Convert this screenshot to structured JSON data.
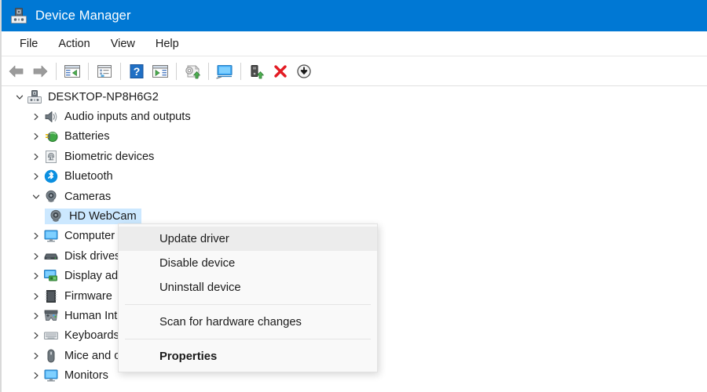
{
  "window": {
    "title": "Device Manager",
    "title_icon": "device-manager-icon",
    "accent_color": "#0078d4",
    "background_color": "#ffffff"
  },
  "menubar": {
    "items": [
      {
        "label": "File"
      },
      {
        "label": "Action"
      },
      {
        "label": "View"
      },
      {
        "label": "Help"
      }
    ]
  },
  "toolbar": {
    "buttons": [
      {
        "icon": "back-arrow-icon",
        "tooltip": "Back"
      },
      {
        "icon": "forward-arrow-icon",
        "tooltip": "Forward"
      },
      {
        "icon": "show-hide-console-tree-icon",
        "tooltip": "Show/Hide Console Tree"
      },
      {
        "icon": "properties-icon",
        "tooltip": "Properties"
      },
      {
        "icon": "help-icon",
        "tooltip": "Help"
      },
      {
        "icon": "show-hide-action-pane-icon",
        "tooltip": "Show/Hide Action Pane"
      },
      {
        "icon": "update-driver-icon",
        "tooltip": "Update driver"
      },
      {
        "icon": "scan-for-hardware-changes-icon",
        "tooltip": "Scan for hardware changes"
      },
      {
        "icon": "uninstall-device-icon",
        "tooltip": "Uninstall device"
      },
      {
        "icon": "disable-device-icon",
        "tooltip": "Disable device"
      },
      {
        "icon": "enable-device-icon",
        "tooltip": "Enable device"
      }
    ]
  },
  "tree": {
    "selection_color": "#cce8ff",
    "root": {
      "label": "DESKTOP-NP8H6G2",
      "icon": "computer-icon",
      "expanded": true
    },
    "nodes": [
      {
        "label": "Audio inputs and outputs",
        "icon": "speaker-icon",
        "expanded": false,
        "level": 1
      },
      {
        "label": "Batteries",
        "icon": "battery-icon",
        "expanded": false,
        "level": 1
      },
      {
        "label": "Biometric devices",
        "icon": "fingerprint-icon",
        "expanded": false,
        "level": 1
      },
      {
        "label": "Bluetooth",
        "icon": "bluetooth-icon",
        "expanded": false,
        "level": 1
      },
      {
        "label": "Cameras",
        "icon": "camera-icon",
        "expanded": true,
        "level": 1
      },
      {
        "label": "HD WebCam",
        "icon": "camera-icon",
        "expanded": null,
        "level": 2,
        "selected": true
      },
      {
        "label": "Computer",
        "icon": "monitor-icon",
        "expanded": false,
        "level": 1
      },
      {
        "label": "Disk drives",
        "icon": "disk-drive-icon",
        "expanded": false,
        "level": 1
      },
      {
        "label": "Display adapters",
        "icon": "display-adapter-icon",
        "expanded": false,
        "level": 1
      },
      {
        "label": "Firmware",
        "icon": "firmware-chip-icon",
        "expanded": false,
        "level": 1
      },
      {
        "label": "Human Interface Devices",
        "icon": "hid-gamepad-icon",
        "expanded": false,
        "level": 1
      },
      {
        "label": "Keyboards",
        "icon": "keyboard-icon",
        "expanded": false,
        "level": 1
      },
      {
        "label": "Mice and other pointing devices",
        "icon": "mouse-icon",
        "expanded": false,
        "level": 1
      },
      {
        "label": "Monitors",
        "icon": "monitor-icon",
        "expanded": false,
        "level": 1
      }
    ]
  },
  "context_menu": {
    "visible": true,
    "target": "HD WebCam",
    "items": [
      {
        "label": "Update driver",
        "highlighted": true,
        "bold": false,
        "type": "item"
      },
      {
        "label": "Disable device",
        "highlighted": false,
        "bold": false,
        "type": "item"
      },
      {
        "label": "Uninstall device",
        "highlighted": false,
        "bold": false,
        "type": "item"
      },
      {
        "type": "separator"
      },
      {
        "label": "Scan for hardware changes",
        "highlighted": false,
        "bold": false,
        "type": "item"
      },
      {
        "type": "separator"
      },
      {
        "label": "Properties",
        "highlighted": false,
        "bold": true,
        "type": "item"
      }
    ]
  }
}
